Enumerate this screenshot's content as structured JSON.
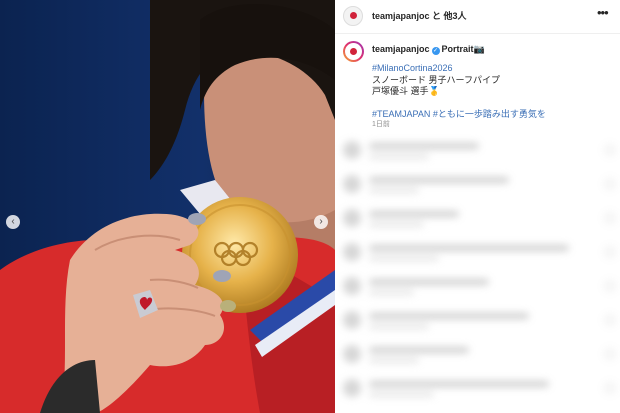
{
  "media": {
    "prev_arrow": "‹",
    "next_arrow": "›"
  },
  "post_header": {
    "username_line": "teamjapanjoc と 他3人",
    "more_icon": "•••"
  },
  "caption": {
    "username": "teamjapanjoc",
    "tag_label": "Portrait📷",
    "lines": [
      "#MilanoCortina2026",
      "スノーボード 男子ハーフパイプ",
      "戸塚優斗 選手🥇",
      "",
      "#TEAMJAPAN #ともに一歩踏み出す勇気を"
    ],
    "timestamp": "1日前"
  },
  "colors": {
    "hashtag": "#3b6fb6",
    "text": "#262626",
    "muted": "#8e8e8e",
    "verified": "#3897f0"
  }
}
